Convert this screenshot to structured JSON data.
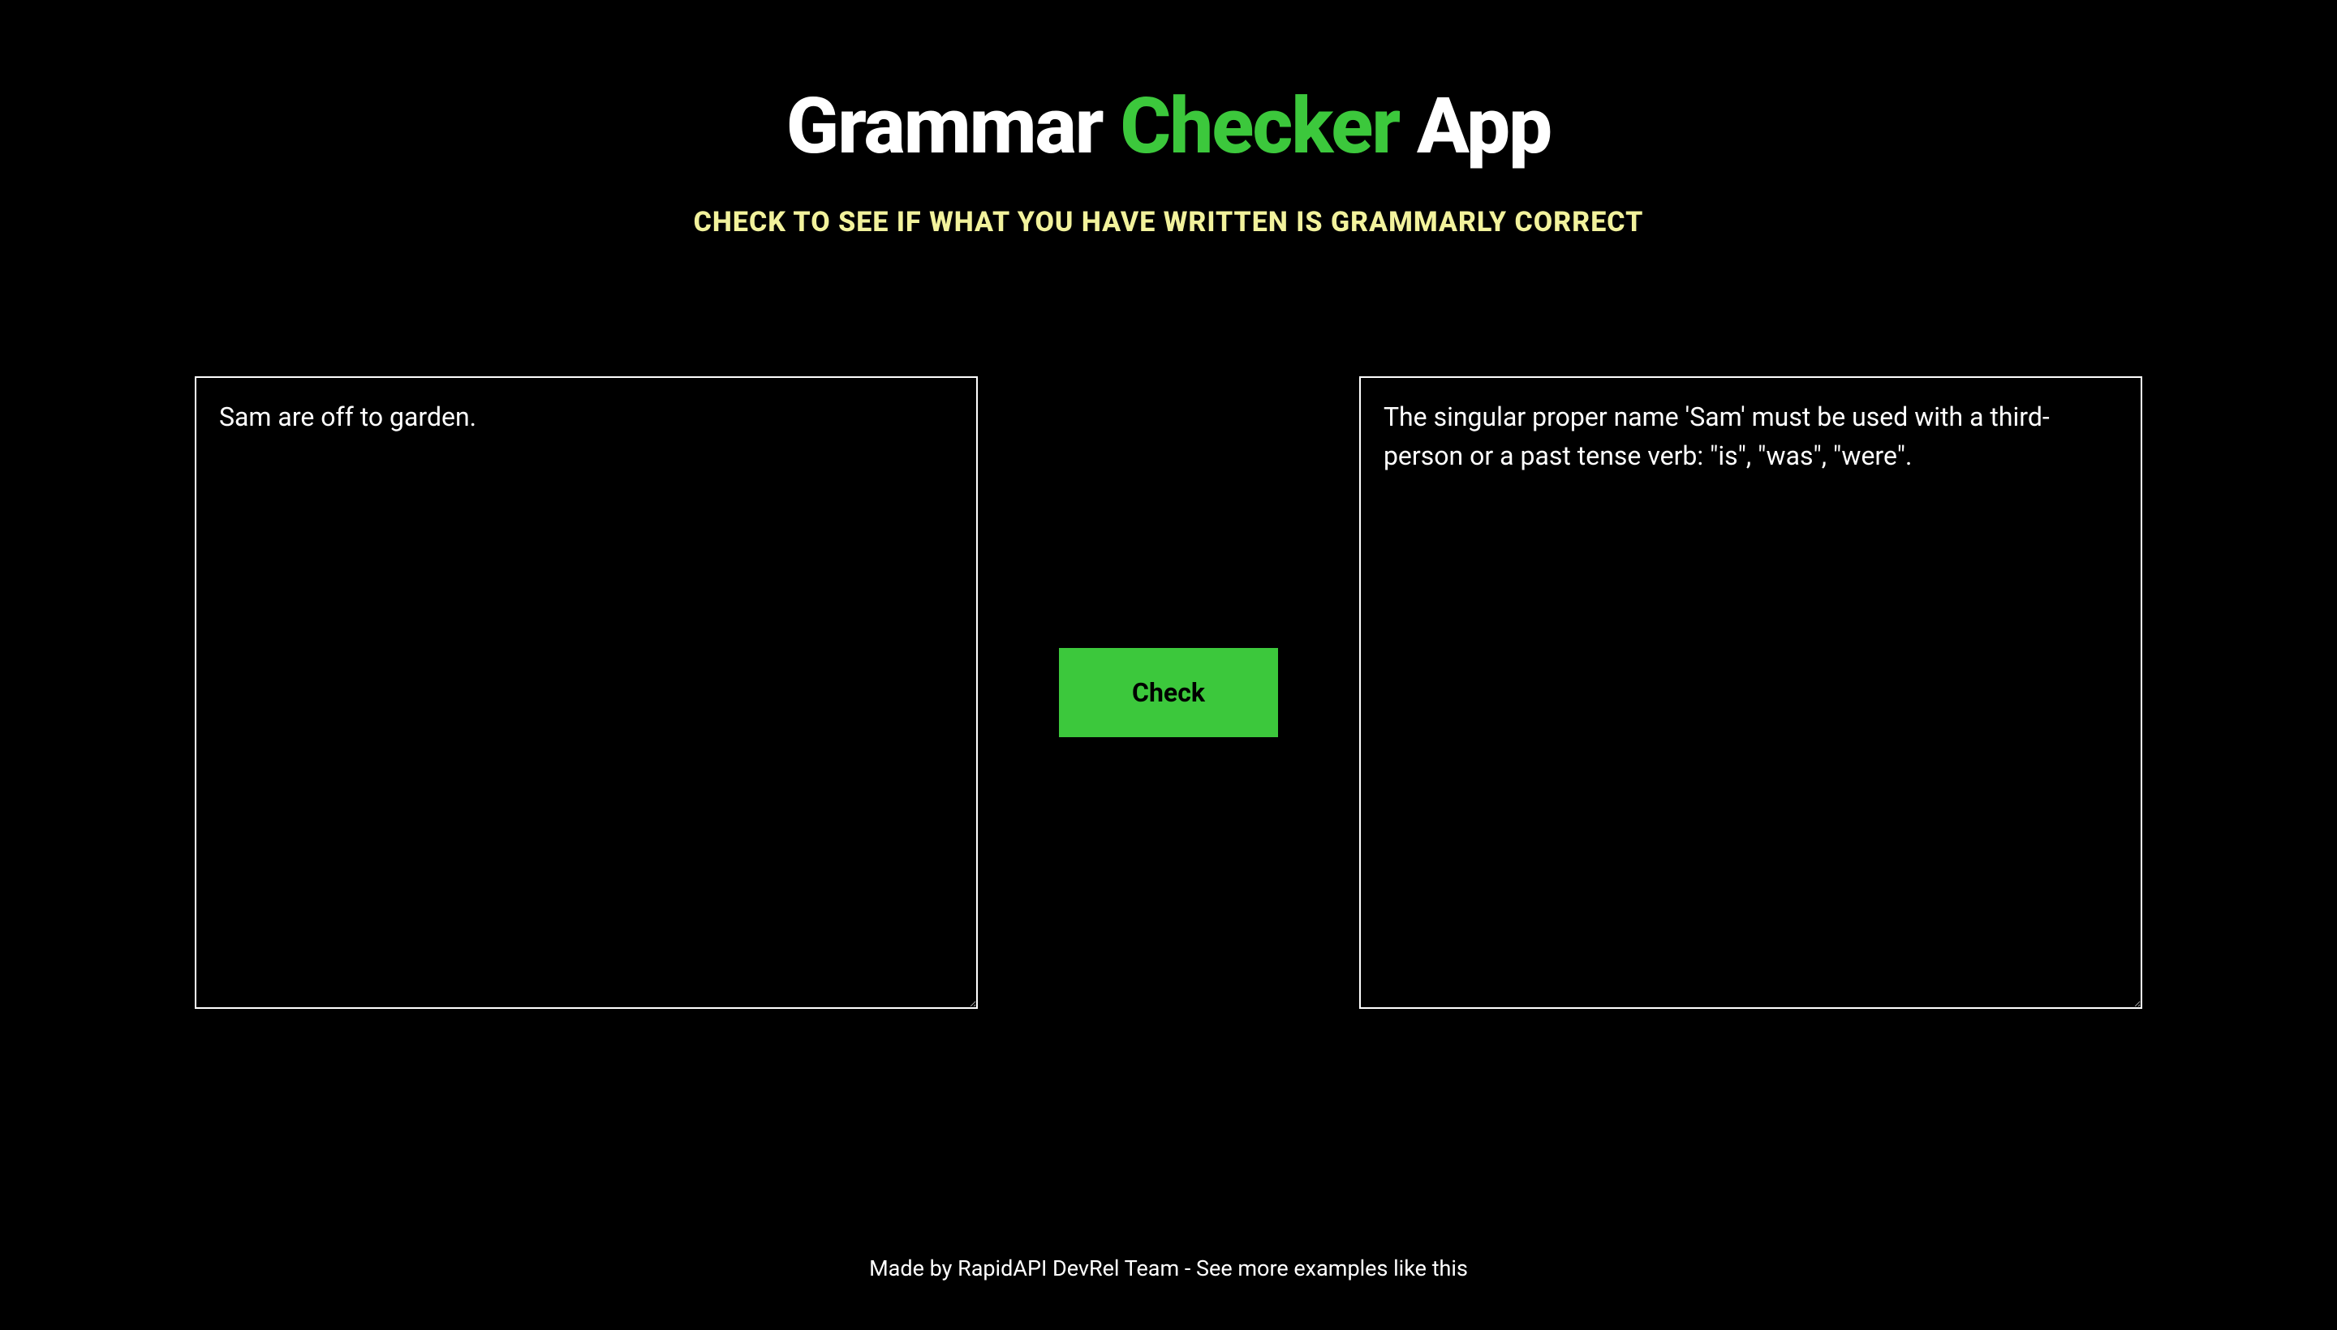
{
  "header": {
    "title_part1": "Grammar ",
    "title_accent": "Checker",
    "title_part2": " App",
    "subtitle": "CHECK TO SEE IF WHAT YOU HAVE WRITTEN IS GRAMMARLY CORRECT"
  },
  "main": {
    "input_value": "Sam are off to garden.",
    "input_placeholder": "",
    "check_button_label": "Check",
    "output_value": "The singular proper name 'Sam' must be used with a third-person or a past tense verb: \"is\", \"was\", \"were\"."
  },
  "footer": {
    "text_prefix": "Made by RapidAPI DevRel Team - ",
    "link_text": "See more examples like this"
  },
  "colors": {
    "accent": "#3cc83c",
    "subtitle": "#f2f29c",
    "background": "#000000",
    "text": "#ffffff"
  }
}
